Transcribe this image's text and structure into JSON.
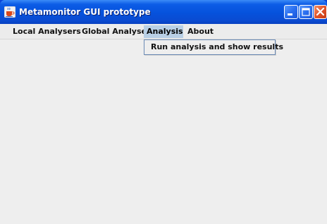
{
  "window": {
    "title": "Metamonitor GUI prototype",
    "icon": "java-cup-icon"
  },
  "menubar": {
    "items": [
      {
        "label": "Local Analysers",
        "active": false
      },
      {
        "label": "Global Analyser",
        "active": false
      },
      {
        "label": "Analysis",
        "active": true
      },
      {
        "label": "About",
        "active": false
      }
    ]
  },
  "analysis_menu": {
    "items": [
      {
        "label": "Run analysis and show results"
      }
    ]
  },
  "colors": {
    "titlebar": "#0652dc",
    "menu_highlight": "#b8cfe5",
    "background": "#eeeeee",
    "close_button": "#e2532a"
  }
}
